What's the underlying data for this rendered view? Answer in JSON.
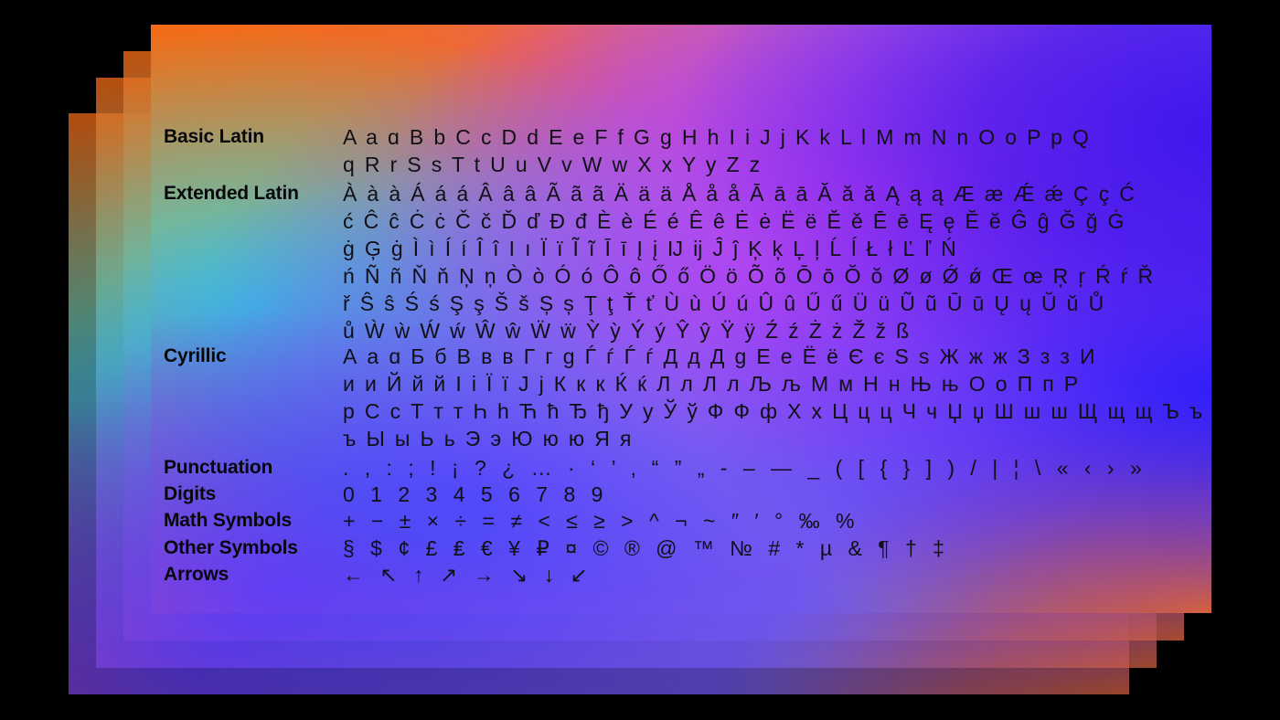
{
  "specimen": {
    "background_color": "#000000",
    "accent_colors": {
      "orange": "#f36c16",
      "cyan": "#2de2de",
      "blue": "#3c14eb",
      "magenta": "#c43cf0",
      "text": "#08080c"
    },
    "layers": [
      {
        "name": "layer-4"
      },
      {
        "name": "layer-3"
      },
      {
        "name": "layer-2"
      },
      {
        "name": "layer-1"
      }
    ],
    "groups": [
      {
        "id": "basic",
        "label": "Basic Latin",
        "lines": [
          "A a ɑ B b C c D d E e F f G g H h I i J j K k L l M m N n O o P p Q",
          "q R r S s T t U u V v W w X x Y y Z z"
        ]
      },
      {
        "id": "extended",
        "label": "Extended Latin",
        "lines": [
          "À à à Á á á Â â â Ã ã ã Ä ä ä Å å å Ā ā ā Ă ă ă Ą ą ą Æ æ Ǽ ǽ Ç ç Ć",
          "ć Ĉ ĉ Ċ ċ Č č Ď ď Đ đ È è É é Ê ê Ė ė Ë ë Ě ě Ē ē Ę ę Ĕ ĕ Ĝ ĝ Ğ ğ Ġ",
          "ġ Ģ ġ Ì ì Í í Î î I ı Ï ï Ĩ ĩ Ī ī Į į Ĳ ĳ Ĵ ĵ Ķ ķ Ļ ļ Ĺ ĺ Ł ł Ľ ľ Ń",
          "ń Ñ ñ Ň ň Ņ ņ Ò ò Ó ó Ô ô Ő ő Ö ö Õ õ Ō ō Ŏ ŏ Ø ø Ǿ ǿ Œ œ Ŗ ŗ Ŕ ŕ Ř",
          "ř Ŝ ŝ Ś ś Ş ş Š š Ș ș Ţ ţ Ť ť Ù ù Ú ú Û û Ű ű Ü ü Ũ ũ Ū ū Ų ų Ŭ ŭ Ů",
          "ů Ẁ ẁ Ẃ ẃ Ŵ ŵ Ẅ ẅ Ỳ ỳ Ý ý Ŷ ŷ Ÿ ÿ Ź ź Ż ż Ž ž ß"
        ]
      },
      {
        "id": "cyrillic",
        "label": "Cyrillic",
        "lines": [
          "А а ɑ Б б В в ʙ Г г ɡ Ѓ ѓ Ѓ ѓ Д д Д g Е е Ё ё Є є Ѕ ѕ Ж ж ж З з з И",
          "и и Й й й І і Ї ї Ј ј К к к Ќ ќ Л л Л л Љ љ М м Н н Њ њ О о П п Р",
          "р С с Т т т Һ һ Ћ ћ Ђ ђ У у Ў ў Ф Ф ф Х х Ц ц ц Ч ч Џ џ Ш ш ш Щ щ щ Ъ ъ",
          "ъ Ы ы Ь ь Э э Ю ю ю Я я"
        ]
      },
      {
        "id": "punctuation",
        "label": "Punctuation",
        "lines": [
          ". , : ; ! ¡ ? ¿ … · ‘ ’ ‚ “ ” „ - – — _ ( [ { } ] ) / | ¦ \\ « ‹ › »"
        ]
      },
      {
        "id": "digits",
        "label": "Digits",
        "lines": [
          "0 1 2 3 4 5 6 7 8 9"
        ]
      },
      {
        "id": "math",
        "label": "Math Symbols",
        "lines": [
          "+ − ± × ÷ = ≠ < ≤ ≥ > ^ ¬ ~ ″ ′ ° ‰ %"
        ]
      },
      {
        "id": "other",
        "label": "Other Symbols",
        "lines": [
          "§ $ ¢ £ ₤ € ¥ ₽ ¤ © ® @ ™ № # * µ & ¶ † ‡"
        ]
      },
      {
        "id": "arrows",
        "label": "Arrows",
        "lines": [
          "← ↖ ↑ ↗ → ↘ ↓ ↙"
        ]
      }
    ]
  }
}
